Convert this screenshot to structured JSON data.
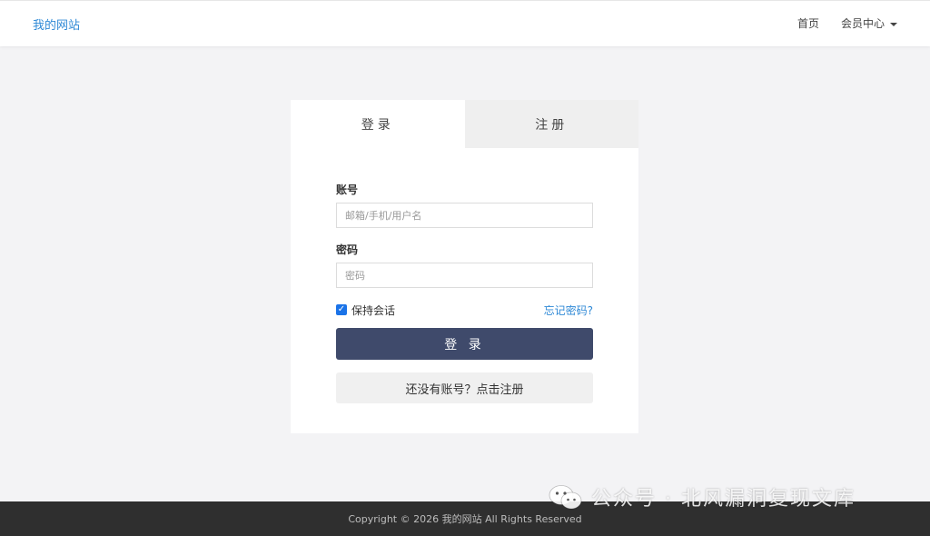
{
  "navbar": {
    "brand": "我的网站",
    "home": "首页",
    "member_center": "会员中心"
  },
  "tabs": {
    "login": "登录",
    "register": "注册"
  },
  "form": {
    "account_label": "账号",
    "account_placeholder": "邮箱/手机/用户名",
    "password_label": "密码",
    "password_placeholder": "密码",
    "remember_label": "保持会话",
    "remember_checked": true,
    "forgot_link": "忘记密码?",
    "login_button": "登 录",
    "register_button": "还没有账号？点击注册"
  },
  "footer": {
    "copyright": "Copyright © 2026 我的网站 All Rights Reserved"
  },
  "watermark": {
    "text": "公众号 · 北风漏洞复现文库"
  },
  "colors": {
    "brand": "#2f89d6",
    "login_button_bg": "#3f4a6b",
    "checkbox": "#1a73e8",
    "footer_bg": "#2f2f2f"
  }
}
